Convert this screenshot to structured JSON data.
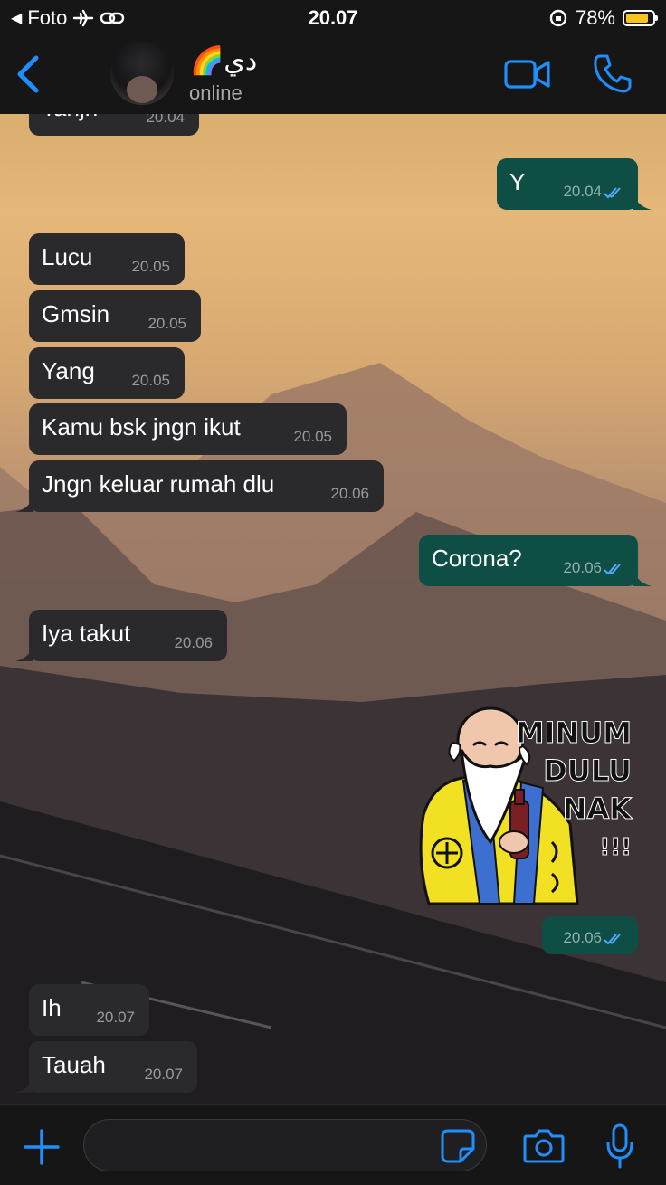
{
  "status_bar": {
    "back_app": "Foto",
    "time": "20.07",
    "battery": "78%"
  },
  "header": {
    "contact_name": "🌈دي",
    "contact_status": "online"
  },
  "messages": [
    {
      "dir": "in",
      "text": "Tanjn",
      "time": "20.04"
    },
    {
      "dir": "out",
      "text": "Y",
      "time": "20.04",
      "read": true
    },
    {
      "dir": "in",
      "text": "Lucu",
      "time": "20.05"
    },
    {
      "dir": "in",
      "text": "Gmsin",
      "time": "20.05"
    },
    {
      "dir": "in",
      "text": "Yang",
      "time": "20.05"
    },
    {
      "dir": "in",
      "text": "Kamu bsk jngn ikut",
      "time": "20.05"
    },
    {
      "dir": "in",
      "text": "Jngn keluar rumah dlu",
      "time": "20.06"
    },
    {
      "dir": "out",
      "text": "Corona?",
      "time": "20.06",
      "read": true
    },
    {
      "dir": "in",
      "text": "Iya takut",
      "time": "20.06"
    },
    {
      "dir": "out",
      "sticker": true,
      "sticker_text": "MINUM DULU NAK !!!",
      "time": "20.06",
      "read": true
    },
    {
      "dir": "in",
      "text": "Ih",
      "time": "20.07"
    },
    {
      "dir": "in",
      "text": "Tauah",
      "time": "20.07"
    }
  ],
  "sticker": {
    "line1": "MINUM",
    "line2": "DULU",
    "line3": "NAK",
    "line4": "!!!"
  },
  "input": {
    "value": "",
    "placeholder": ""
  },
  "colors": {
    "accent": "#1e8fff",
    "incoming_bubble": "#2a2a2c",
    "outgoing_bubble": "#0e4e45",
    "read_ticks": "#4fa9ff"
  }
}
